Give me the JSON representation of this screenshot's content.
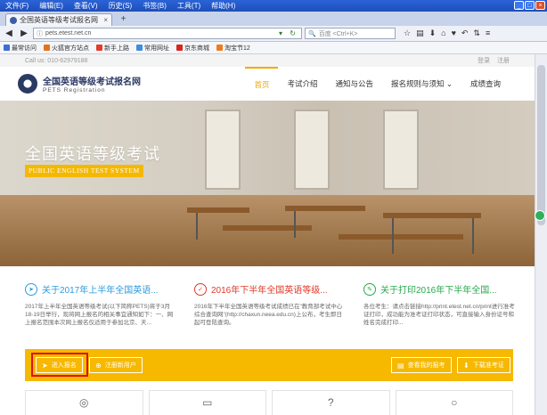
{
  "browser": {
    "menu": [
      "文件(F)",
      "编辑(E)",
      "查看(V)",
      "历史(S)",
      "书签(B)",
      "工具(T)",
      "帮助(H)"
    ],
    "tab_title": "全国英语等级考试报名网",
    "url": "pets.etest.net.cn",
    "search_placeholder": "百度 <Ctrl+K>",
    "bookmarks": [
      {
        "label": "最常访问",
        "color": "#3b6fd6"
      },
      {
        "label": "火狐官方站点",
        "color": "#e5731b"
      },
      {
        "label": "新手上路",
        "color": "#e33b2b"
      },
      {
        "label": "常用网址",
        "color": "#3f8ee0"
      },
      {
        "label": "京东商城",
        "color": "#d7261e"
      },
      {
        "label": "淘宝节12",
        "color": "#f07b1d"
      }
    ]
  },
  "site": {
    "contact": "Call us: 010-62979188",
    "login": "登录",
    "register": "注册",
    "brand_cn": "全国英语等级考试报名网",
    "brand_en": "PETS Registration",
    "nav": [
      "首页",
      "考试介绍",
      "通知与公告",
      "报名规则与须知 ⌄",
      "成绩查询"
    ],
    "hero_title": "全国英语等级考试",
    "hero_sub": "PUBLIC ENGLISH TEST SYSTEM"
  },
  "news": [
    {
      "title": "关于2017年上半年全国英语...",
      "body": "2017年上半年全国英语等级考试(以下简称PETS)将于3月18-19日举行，现将网上报名的相关事宜通知如下：一、网上报名范围本次网上报名仅适用于参加北京、天...",
      "color": "#2d9be0",
      "icon": "plane-icon"
    },
    {
      "title": "2016年下半年全国英语等级...",
      "body": "2016年下半年全国英语等级考试成绩已在\"教育部考试中心综合查询网\"(http://chaxun.neea.edu.cn)上公布，考生即日起可登陆查询。",
      "color": "#e2392a",
      "icon": "check-icon"
    },
    {
      "title": "关于打印2016年下半年全国...",
      "body": "各位考生：请点击链接http://print.etest.net.cn/print进行准考证打印，成功能为准考证打印状态，可直接输入身份证号和姓名完成打印...",
      "color": "#27a94e",
      "icon": "wrench-icon"
    }
  ],
  "actions": {
    "enter": "进入报名",
    "register_user": "注册新用户",
    "view_report": "查看我的报考",
    "download_ticket": "下载准考证"
  }
}
